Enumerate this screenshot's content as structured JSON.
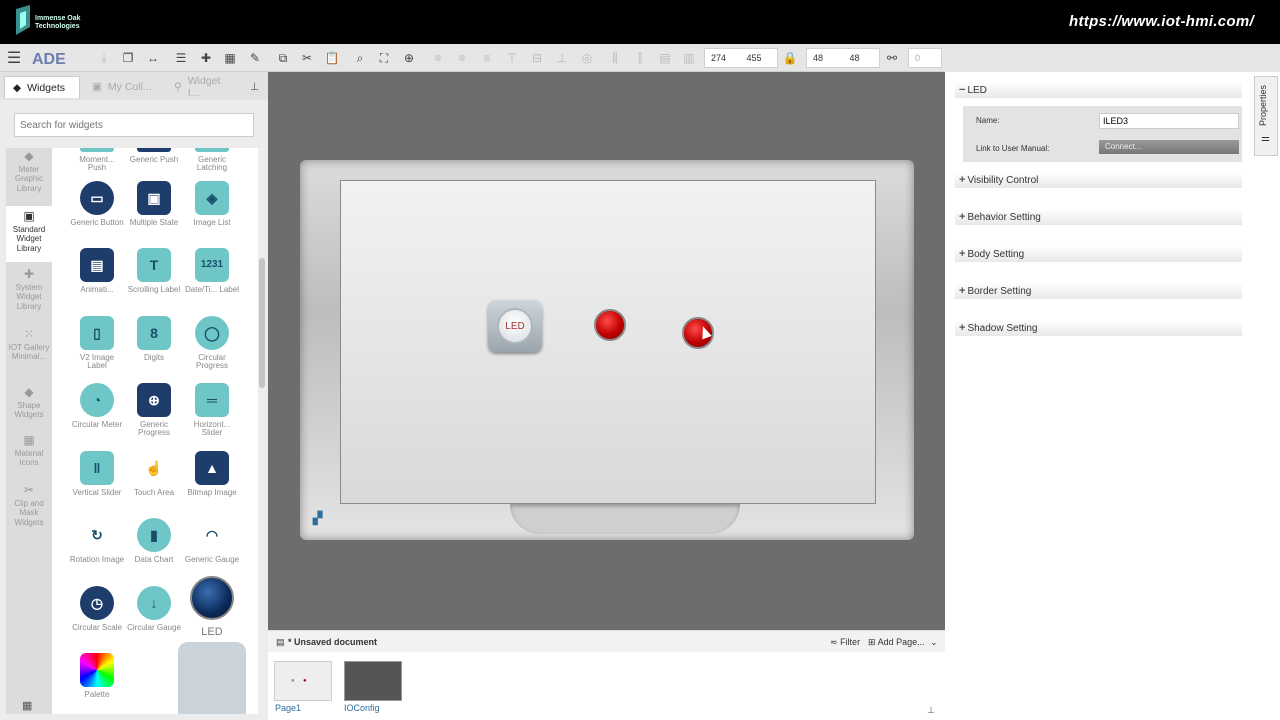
{
  "topbar": {
    "logo_text_line1": "Immense Oak",
    "logo_text_line2": "Technologies",
    "url": "https://www.iot-hmi.com/"
  },
  "toolbar": {
    "pos_x": "274",
    "pos_y": "455",
    "width": "48",
    "height": "48",
    "rotation": "0"
  },
  "left_panel": {
    "tabs": [
      {
        "label": "Widgets"
      },
      {
        "label": "My Coll..."
      },
      {
        "label": "Widget I..."
      }
    ],
    "search_placeholder": "Search for widgets",
    "categories": [
      {
        "label": "Meter Graphic Library"
      },
      {
        "label": "Standard Widget Library"
      },
      {
        "label": "System Widget Library"
      },
      {
        "label": "IOT Gallery Minimal..."
      },
      {
        "label": "Shape Widgets"
      },
      {
        "label": "Material Icons"
      },
      {
        "label": "Clip and Mask Widgets"
      }
    ],
    "widgets": [
      {
        "label": "Moment... Push"
      },
      {
        "label": "Generic Push"
      },
      {
        "label": "Generic Latching"
      },
      {
        "label": "Generic Button"
      },
      {
        "label": "Multiple State"
      },
      {
        "label": "Image List"
      },
      {
        "label": "Animati..."
      },
      {
        "label": "Scrolling Label"
      },
      {
        "label": "Date/Ti... Label"
      },
      {
        "label": "V2 Image Label"
      },
      {
        "label": "Digits"
      },
      {
        "label": "Circular Progress"
      },
      {
        "label": "Circular Meter"
      },
      {
        "label": "Generic Progress"
      },
      {
        "label": "Horizont... Slider"
      },
      {
        "label": "Vertical Slider"
      },
      {
        "label": "Touch Area"
      },
      {
        "label": "Bitmap Image"
      },
      {
        "label": "Rotation Image"
      },
      {
        "label": "Data Chart"
      },
      {
        "label": "Generic Gauge"
      },
      {
        "label": "Circular Scale"
      },
      {
        "label": "Circular Gauge"
      },
      {
        "label": "LED"
      },
      {
        "label": "Palette"
      }
    ]
  },
  "canvas": {
    "led_button_label": "LED"
  },
  "document": {
    "title": "* Unsaved document",
    "filter_label": "Filter",
    "add_page_label": "Add Page...",
    "pages": [
      {
        "label": "Page1"
      },
      {
        "label": "IOConfig"
      }
    ]
  },
  "properties": {
    "tab_label": "Properties",
    "led_section": "LED",
    "name_label": "Name:",
    "name_value": "ILED3",
    "manual_label": "Link to User Manual:",
    "connect_label": "Connect...",
    "sections": [
      {
        "label": "Visibility Control"
      },
      {
        "label": "Behavior Setting"
      },
      {
        "label": "Body Setting"
      },
      {
        "label": "Border Setting"
      },
      {
        "label": "Shadow Setting"
      }
    ]
  }
}
